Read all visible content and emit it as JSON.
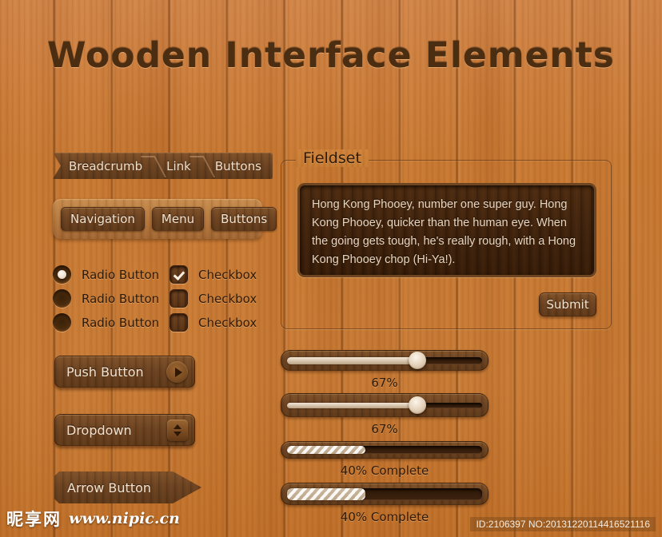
{
  "page": {
    "title": "Wooden Interface Elements"
  },
  "breadcrumb": {
    "items": [
      {
        "label": "Breadcrumb"
      },
      {
        "label": "Link"
      },
      {
        "label": "Buttons"
      }
    ]
  },
  "navbar": {
    "items": [
      {
        "label": "Navigation"
      },
      {
        "label": "Menu"
      },
      {
        "label": "Buttons"
      }
    ]
  },
  "radios": [
    {
      "label": "Radio Button",
      "selected": true
    },
    {
      "label": "Radio Button",
      "selected": false
    },
    {
      "label": "Radio Button",
      "selected": false
    }
  ],
  "checkboxes": [
    {
      "label": "Checkbox",
      "checked": true
    },
    {
      "label": "Checkbox",
      "checked": false
    },
    {
      "label": "Checkbox",
      "checked": false
    }
  ],
  "push_button": {
    "label": "Push Button",
    "icon": "play-triangle-icon"
  },
  "dropdown": {
    "label": "Dropdown",
    "icon": "up-down-stepper-icon"
  },
  "arrow_button": {
    "label": "Arrow Button"
  },
  "fieldset": {
    "legend": "Fieldset",
    "textarea_value": "Hong Kong Phooey, number one super guy. Hong Kong Phooey, quicker than the human eye. When the going gets tough, he's really rough, with a Hong Kong Phooey chop (Hi-Ya!).",
    "submit_label": "Submit"
  },
  "sliders": [
    {
      "value": 67,
      "caption": "67%"
    },
    {
      "value": 67,
      "caption": "67%"
    }
  ],
  "progress": [
    {
      "value": 40,
      "caption": "40%  Complete"
    },
    {
      "value": 40,
      "caption": "40%  Complete"
    }
  ],
  "watermark": {
    "cn": "昵享网",
    "url": "www.nipic.cn"
  },
  "id_tag": "ID:2106397 NO:20131220114416521116",
  "colors": {
    "wood_base": "#c87b33",
    "wood_dark": "#6b4423",
    "text_light": "#f2e3d0",
    "text_dark": "#2e1a08"
  }
}
